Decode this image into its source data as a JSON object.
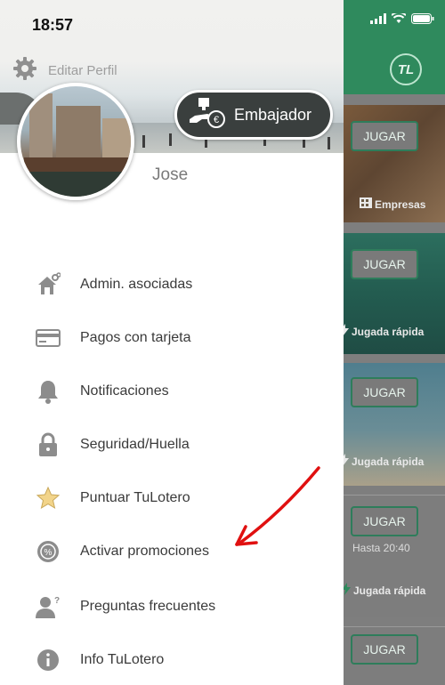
{
  "status_bar": {
    "time": "18:57"
  },
  "drawer": {
    "settings_label": "Editar Perfil",
    "username": "Jose",
    "ambassador_label": "Embajador",
    "menu": [
      {
        "id": "admin",
        "icon": "house-link-icon",
        "label": "Admin. asociadas"
      },
      {
        "id": "cards",
        "icon": "credit-card-icon",
        "label": "Pagos con tarjeta"
      },
      {
        "id": "notif",
        "icon": "bell-icon",
        "label": "Notificaciones"
      },
      {
        "id": "security",
        "icon": "lock-icon",
        "label": "Seguridad/Huella"
      },
      {
        "id": "rate",
        "icon": "star-icon",
        "label": "Puntuar TuLotero"
      },
      {
        "id": "promos",
        "icon": "percent-badge-icon",
        "label": "Activar promociones"
      },
      {
        "id": "faq",
        "icon": "user-question-icon",
        "label": "Preguntas frecuentes"
      },
      {
        "id": "info",
        "icon": "info-icon",
        "label": "Info TuLotero"
      }
    ]
  },
  "background_app": {
    "logo": "TL",
    "cards": [
      {
        "button": "JUGAR",
        "label": "Empresas"
      },
      {
        "button": "JUGAR",
        "label": "Jugada rápida"
      },
      {
        "button": "JUGAR",
        "label": "Jugada rápida"
      },
      {
        "button": "JUGAR",
        "sub": "Hasta 20:40",
        "label": "Jugada rápida"
      },
      {
        "button": "JUGAR"
      }
    ]
  },
  "colors": {
    "brand_green": "#2f8a5d",
    "menu_icon_gray": "#8c8c8c",
    "star_yellow": "#f2d48a",
    "annotation_red": "#e01010"
  }
}
